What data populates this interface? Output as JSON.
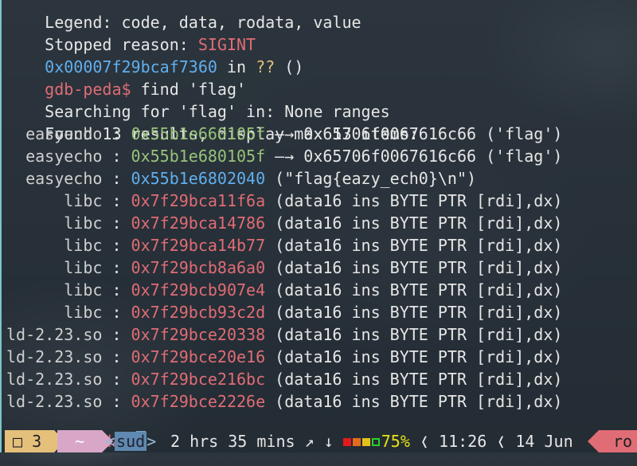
{
  "terminal": {
    "legend_partial": "Legend: code, data, rodata, value",
    "stopped_label": "Stopped reason: ",
    "stopped_value": "SIGINT",
    "frame_addr": "0x00007f29bcaf7360",
    "frame_in": " in ",
    "frame_func": "??",
    "frame_args": " ()",
    "prompt": "gdb-peda$",
    "command": " find 'flag'",
    "searching": "Searching for 'flag' in: None ranges",
    "found": "Found 13 results, display max 13 items:",
    "results": [
      {
        "region": "  easyecho",
        "sep": " : ",
        "addr": "0x55b1e660105f",
        "addr_color": "green",
        "rest": " —→ 0x65706f0067616c66 ('flag')"
      },
      {
        "region": "  easyecho",
        "sep": " : ",
        "addr": "0x55b1e680105f",
        "addr_color": "green",
        "rest": " —→ 0x65706f0067616c66 ('flag')"
      },
      {
        "region": "  easyecho",
        "sep": " : ",
        "addr": "0x55b1e6802040",
        "addr_color": "cyan",
        "rest": " (\"flag{eazy_ech0}\\n\")"
      },
      {
        "region": "      libc",
        "sep": " : ",
        "addr": "0x7f29bca11f6a",
        "addr_color": "red",
        "rest": " (data16 ins BYTE PTR [rdi],dx)"
      },
      {
        "region": "      libc",
        "sep": " : ",
        "addr": "0x7f29bca14786",
        "addr_color": "red",
        "rest": " (data16 ins BYTE PTR [rdi],dx)"
      },
      {
        "region": "      libc",
        "sep": " : ",
        "addr": "0x7f29bca14b77",
        "addr_color": "red",
        "rest": " (data16 ins BYTE PTR [rdi],dx)"
      },
      {
        "region": "      libc",
        "sep": " : ",
        "addr": "0x7f29bcb8a6a0",
        "addr_color": "red",
        "rest": " (data16 ins BYTE PTR [rdi],dx)"
      },
      {
        "region": "      libc",
        "sep": " : ",
        "addr": "0x7f29bcb907e4",
        "addr_color": "red",
        "rest": " (data16 ins BYTE PTR [rdi],dx)"
      },
      {
        "region": "      libc",
        "sep": " : ",
        "addr": "0x7f29bcb93c2d",
        "addr_color": "red",
        "rest": " (data16 ins BYTE PTR [rdi],dx)"
      },
      {
        "region": "ld-2.23.so",
        "sep": " : ",
        "addr": "0x7f29bce20338",
        "addr_color": "red",
        "rest": " (data16 ins BYTE PTR [rdi],dx)"
      },
      {
        "region": "ld-2.23.so",
        "sep": " : ",
        "addr": "0x7f29bce20e16",
        "addr_color": "red",
        "rest": " (data16 ins BYTE PTR [rdi],dx)"
      },
      {
        "region": "ld-2.23.so",
        "sep": " : ",
        "addr": "0x7f29bce216bc",
        "addr_color": "red",
        "rest": " (data16 ins BYTE PTR [rdi],dx)"
      },
      {
        "region": "ld-2.23.so",
        "sep": " : ",
        "addr": "0x7f29bce2226e",
        "addr_color": "red",
        "rest": " (data16 ins BYTE PTR [rdi],dx)"
      }
    ]
  },
  "statusbar": {
    "workspace_icon": "□",
    "workspace": "3",
    "dir": "~",
    "sud_left": "<",
    "sud": "sud",
    "sud_right": ">",
    "uptime": "2 hrs 35 mins",
    "net_icons": "↗ ↓",
    "battery_colors": [
      "#e11b1b",
      "#e56b1b",
      "#e5c01b",
      "#2bd12b"
    ],
    "battery_pct": "75%",
    "sep_icon": "❬",
    "time": "11:26",
    "date": "14 Jun",
    "tail": "ro"
  }
}
